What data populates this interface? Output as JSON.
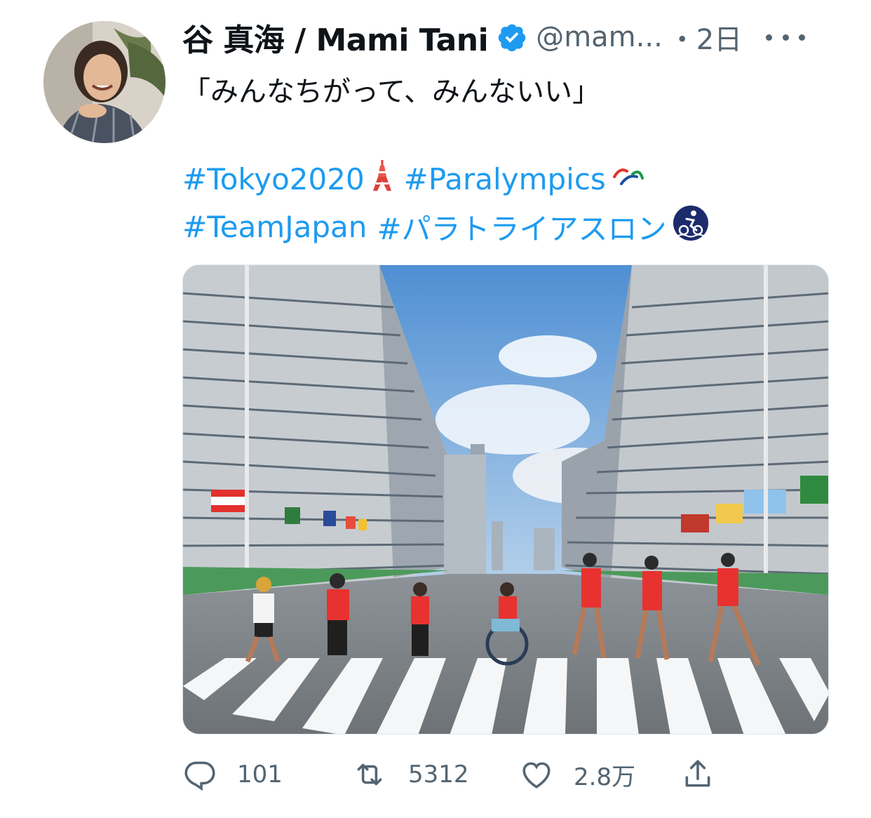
{
  "author": {
    "name": "谷 真海 / Mami Tani",
    "handle": "@mam...",
    "time": "・2日",
    "verified": true
  },
  "tweet": {
    "line1": "「みんなちがって、みんないい」",
    "hashtags_row1": [
      "#Tokyo2020",
      "#Paralympics"
    ],
    "hashtags_row2": [
      "#TeamJapan",
      "#パラトライアスロン"
    ],
    "emojis": [
      "tokyo-tower-emoji",
      "paralympics-agitos-emoji",
      "triathlon-emoji"
    ]
  },
  "actions": {
    "replies": "101",
    "retweets": "5312",
    "likes": "2.8万"
  },
  "colors": {
    "link": "#1d9bf0",
    "secondary": "#536471",
    "verified": "#1d9bf0"
  }
}
